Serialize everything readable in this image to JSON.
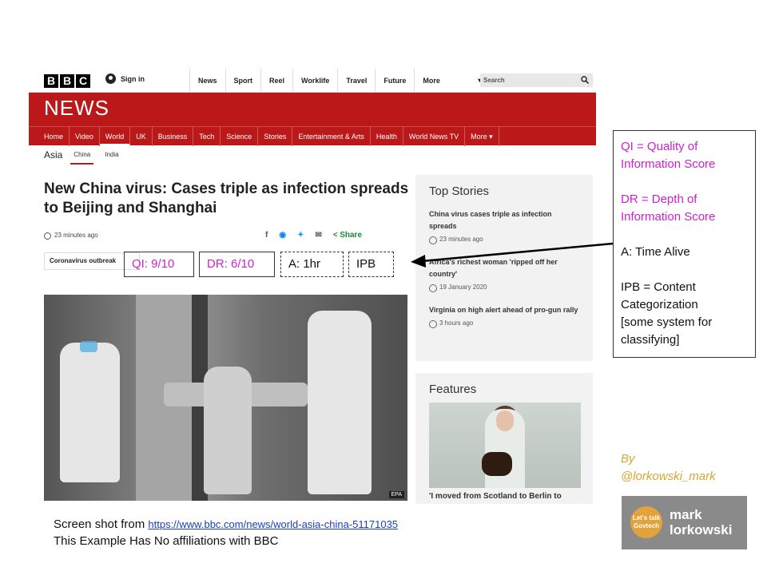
{
  "bbc": {
    "logo_letters": [
      "B",
      "B",
      "C"
    ],
    "signin": "Sign in",
    "topnav": [
      "News",
      "Sport",
      "Reel",
      "Worklife",
      "Travel",
      "Future",
      "More"
    ],
    "search_placeholder": "Search",
    "wordmark": "NEWS",
    "sections": [
      "Home",
      "Video",
      "World",
      "UK",
      "Business",
      "Tech",
      "Science",
      "Stories",
      "Entertainment & Arts",
      "Health",
      "World News TV",
      "More ▾"
    ],
    "subnav": {
      "region": "Asia",
      "items": [
        "China",
        "India"
      ]
    },
    "headline": "New China virus: Cases triple as infection spreads to Beijing and Shanghai",
    "time_ago": "23 minutes ago",
    "share_label": "Share",
    "topic_tag": "Coronavirus outbreak",
    "photo_credit": "EPA",
    "top_stories": {
      "title": "Top Stories",
      "items": [
        {
          "title": "China virus cases triple as infection spreads",
          "time": "23 minutes ago"
        },
        {
          "title": "Africa's richest woman 'ripped off her country'",
          "time": "19 January 2020"
        },
        {
          "title": "Virginia on high alert ahead of pro-gun rally",
          "time": "3 hours ago"
        }
      ]
    },
    "features": {
      "title": "Features",
      "caption": "'I moved from Scotland to Berlin to"
    }
  },
  "annotations": {
    "qi": "QI: 9/10",
    "dr": "DR: 6/10",
    "a": "A: 1hr",
    "ipb": "IPB"
  },
  "legend": {
    "qi_line1": "QI = Quality of",
    "qi_line2": "Information Score",
    "dr_line1": "DR = Depth of",
    "dr_line2": "Information Score",
    "a_line": "A: Time Alive",
    "ipb_line1": "IPB = Content",
    "ipb_line2": "Categorization",
    "ipb_line3": "[some system for",
    "ipb_line4": "classifying]"
  },
  "caption": {
    "prefix": "Screen shot from ",
    "url": "https://www.bbc.com/news/world-asia-china-51171035",
    "line2": "This Example Has No affiliations with BBC"
  },
  "byline": {
    "line1": "By",
    "line2": "@lorkowski_mark"
  },
  "logo": {
    "badge_line1": "Let's talk",
    "badge_line2": "Govtech",
    "name_line1": "mark",
    "name_line2": "lorkowski"
  },
  "colors": {
    "bbc_red": "#bb1919",
    "annotation_pink": "#cc22cc",
    "byline_gold": "#d9a533"
  }
}
